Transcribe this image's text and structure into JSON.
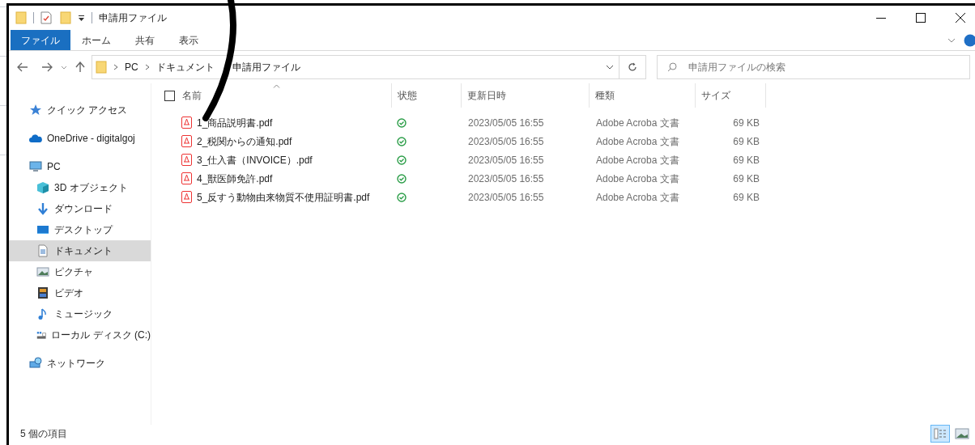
{
  "window": {
    "title": "申請用ファイル"
  },
  "ribbon_tabs": [
    {
      "label": "ファイル",
      "selected": true
    },
    {
      "label": "ホーム",
      "selected": false
    },
    {
      "label": "共有",
      "selected": false
    },
    {
      "label": "表示",
      "selected": false
    }
  ],
  "address": {
    "segments": [
      "PC",
      "ドキュメント",
      "申請用ファイル"
    ]
  },
  "search": {
    "placeholder": "申請用ファイルの検索"
  },
  "sidebar": {
    "items": [
      {
        "label": "クイック アクセス",
        "kind": "star",
        "selected": false
      },
      {
        "label": "OneDrive - digitalgoj",
        "kind": "cloud",
        "selected": false
      },
      {
        "label": "PC",
        "kind": "pc",
        "selected": false,
        "children": [
          {
            "label": "3D オブジェクト",
            "kind": "cube",
            "selected": false
          },
          {
            "label": "ダウンロード",
            "kind": "download",
            "selected": false
          },
          {
            "label": "デスクトップ",
            "kind": "desktop",
            "selected": false
          },
          {
            "label": "ドキュメント",
            "kind": "document",
            "selected": true
          },
          {
            "label": "ピクチャ",
            "kind": "picture",
            "selected": false
          },
          {
            "label": "ビデオ",
            "kind": "video",
            "selected": false
          },
          {
            "label": "ミュージック",
            "kind": "music",
            "selected": false
          },
          {
            "label": "ローカル ディスク (C:)",
            "kind": "disk",
            "selected": false
          }
        ]
      },
      {
        "label": "ネットワーク",
        "kind": "network",
        "selected": false
      }
    ]
  },
  "table": {
    "select_all": {
      "checked": false
    },
    "columns": [
      "名前",
      "状態",
      "更新日時",
      "種類",
      "サイズ"
    ],
    "rows": [
      {
        "name": "1_商品説明書.pdf",
        "modified": "2023/05/05 16:55",
        "type": "Adobe Acroba 文書",
        "size": "69 KB"
      },
      {
        "name": "2_税関からの通知.pdf",
        "modified": "2023/05/05 16:55",
        "type": "Adobe Acroba 文書",
        "size": "69 KB"
      },
      {
        "name": "3_仕入書（INVOICE）.pdf",
        "modified": "2023/05/05 16:55",
        "type": "Adobe Acroba 文書",
        "size": "69 KB"
      },
      {
        "name": "4_獣医師免許.pdf",
        "modified": "2023/05/05 16:55",
        "type": "Adobe Acroba 文書",
        "size": "69 KB"
      },
      {
        "name": "5_反すう動物由来物質不使用証明書.pdf",
        "modified": "2023/05/05 16:55",
        "type": "Adobe Acroba 文書",
        "size": "69 KB"
      }
    ]
  },
  "status_bar": {
    "item_count": "5 個の項目",
    "views": [
      {
        "kind": "details",
        "selected": true
      },
      {
        "kind": "large",
        "selected": false
      }
    ]
  }
}
